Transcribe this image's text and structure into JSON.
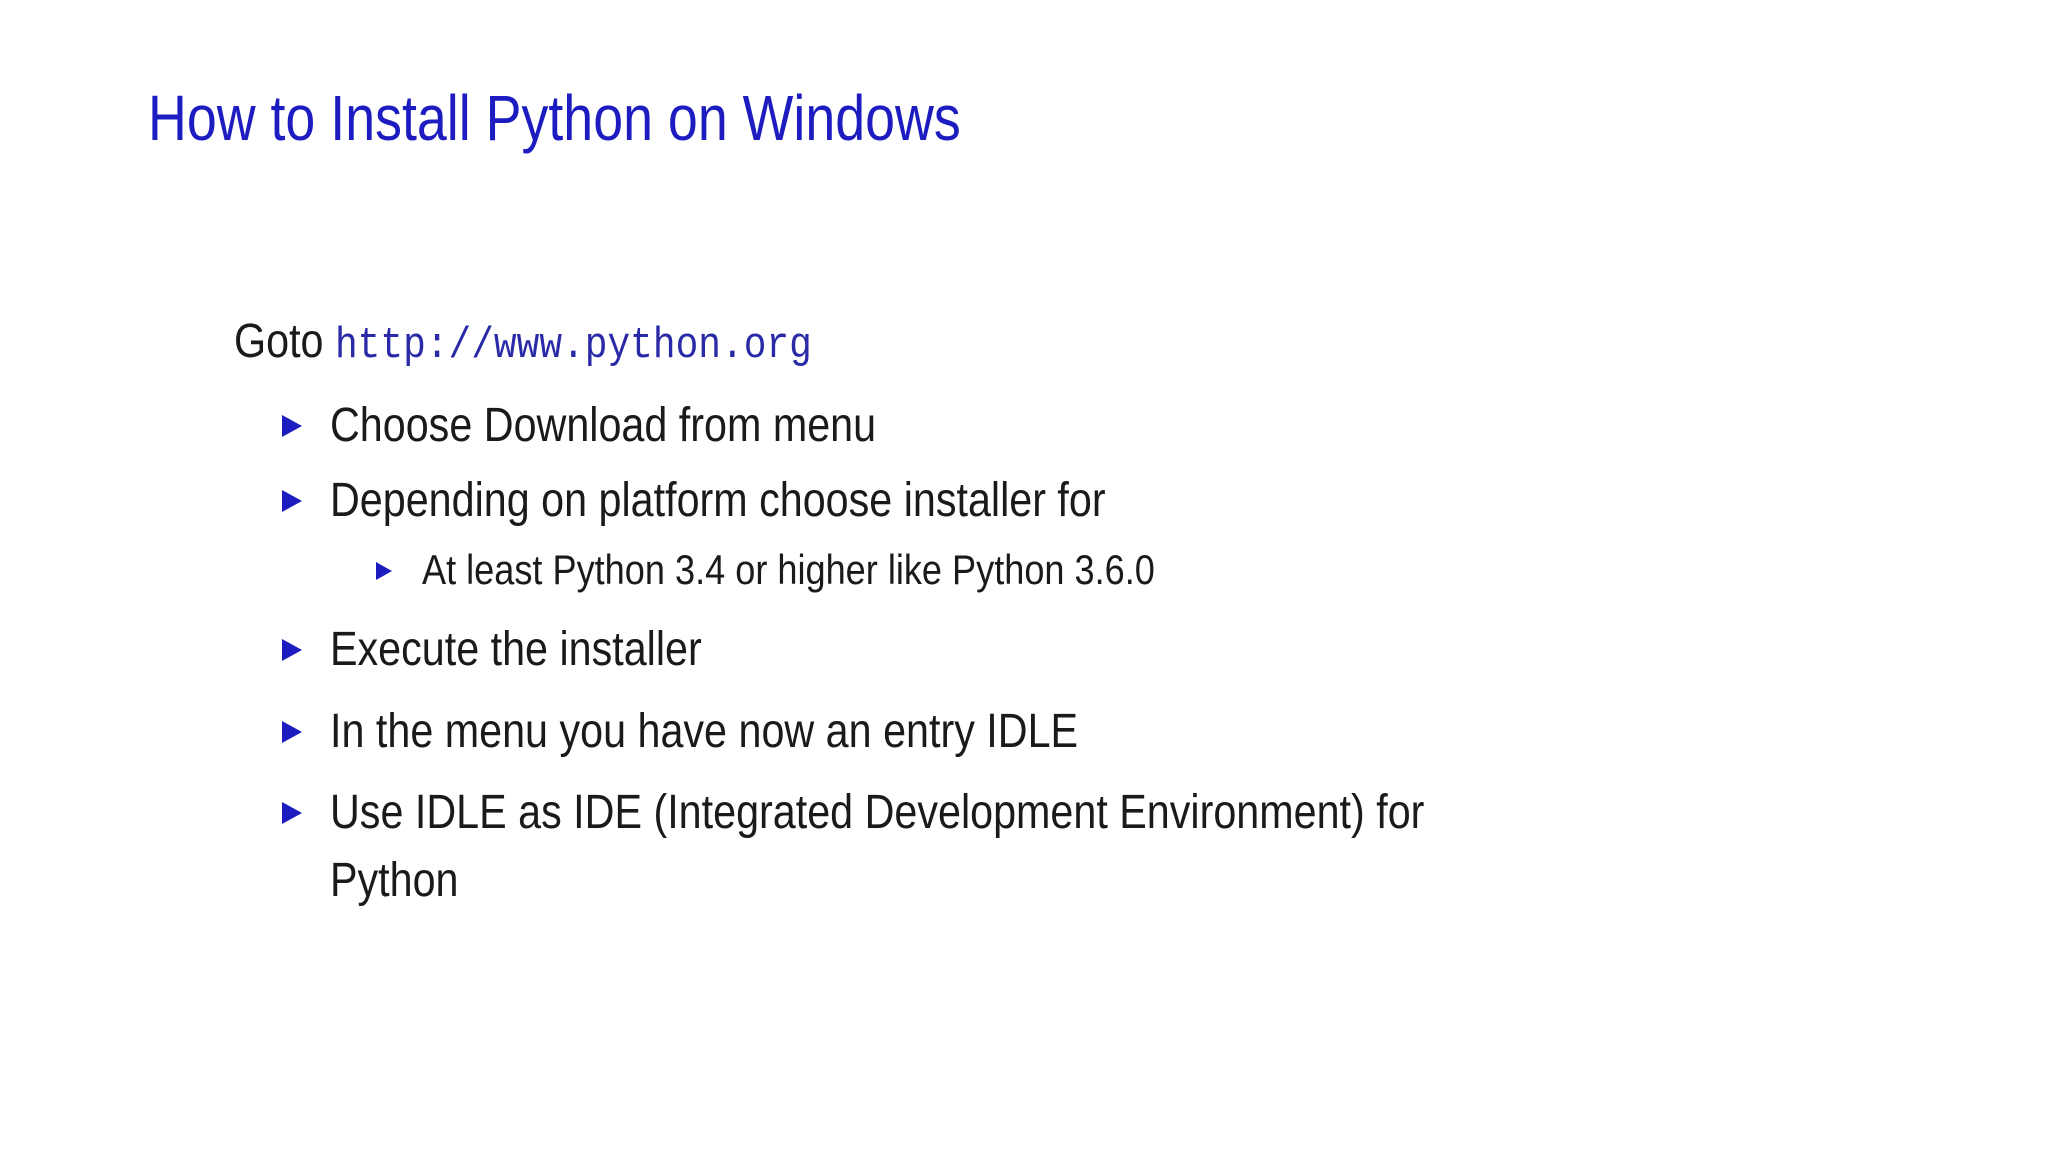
{
  "slide": {
    "title": "How to Install Python on Windows",
    "intro": {
      "prefix": "Goto ",
      "url": "http://www.python.org"
    },
    "bullets": [
      {
        "text": "Choose Download from menu"
      },
      {
        "text": "Depending on platform choose installer for"
      },
      {
        "text": "At least Python 3.4 or higher like Python 3.6.0",
        "level": 2
      },
      {
        "text": "Execute the installer"
      },
      {
        "text": "In the menu you have now an entry IDLE"
      },
      {
        "text_line1": "Use IDLE as IDE (Integrated Development Environment) for",
        "text_line2": "Python"
      }
    ],
    "colors": {
      "title": "#1c1cc0",
      "bullet_marker": "#1c1cc0",
      "url": "#2a2aa8",
      "text": "#1a1a1a"
    },
    "icons": {
      "bullet": "triangle-right-icon"
    }
  }
}
